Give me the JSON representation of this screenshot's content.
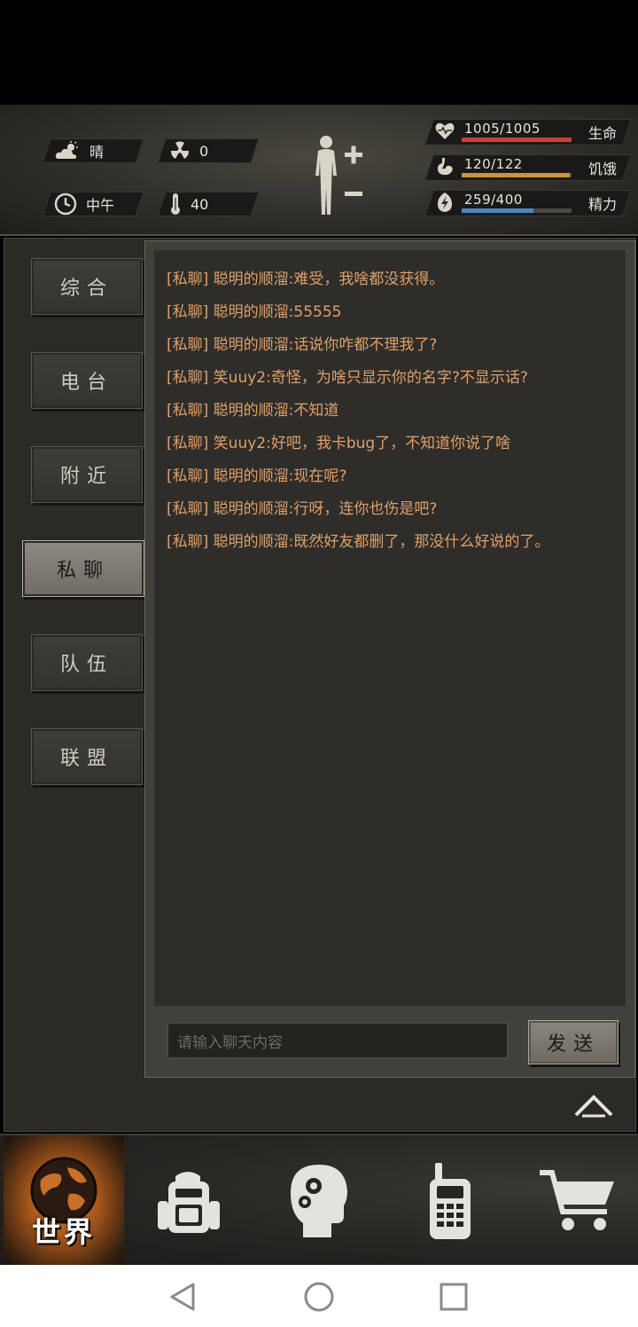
{
  "header": {
    "weather": {
      "icon": "cloud-sun-icon",
      "label": "晴"
    },
    "radiation": {
      "icon": "radiation-icon",
      "value": "0"
    },
    "time": {
      "icon": "clock-icon",
      "label": "中午"
    },
    "temperature": {
      "icon": "thermometer-icon",
      "value": "40"
    },
    "stats": [
      {
        "icon": "heart-icon",
        "value": "1005/1005",
        "name": "生命",
        "fraction": 1.0,
        "color": "#c9423a"
      },
      {
        "icon": "stomach-icon",
        "value": "120/122",
        "name": "饥饿",
        "fraction": 0.98,
        "color": "#c6982f"
      },
      {
        "icon": "energy-icon",
        "value": "259/400",
        "name": "精力",
        "fraction": 0.65,
        "color": "#4f86c6"
      }
    ]
  },
  "tabs": [
    {
      "label": "综合",
      "active": false
    },
    {
      "label": "电台",
      "active": false
    },
    {
      "label": "附近",
      "active": false
    },
    {
      "label": "私聊",
      "active": true
    },
    {
      "label": "队伍",
      "active": false
    },
    {
      "label": "联盟",
      "active": false
    }
  ],
  "chat": {
    "messages": [
      "[私聊] 聪明的顺溜:难受，我啥都没获得。",
      "[私聊] 聪明的顺溜:55555",
      "[私聊] 聪明的顺溜:话说你咋都不理我了?",
      "[私聊] 笑uuy2:奇怪，为啥只显示你的名字?不显示话?",
      "[私聊] 聪明的顺溜:不知道",
      "[私聊] 笑uuy2:好吧，我卡bug了，不知道你说了啥",
      "[私聊] 聪明的顺溜:现在呢?",
      "[私聊] 聪明的顺溜:行呀，连你也伤是吧?",
      "[私聊] 聪明的顺溜:既然好友都删了，那没什么好说的了。"
    ],
    "input_placeholder": "请输入聊天内容",
    "send_label": "发送"
  },
  "bottom_nav": [
    {
      "icon": "globe-icon",
      "label": "世界",
      "active": true
    },
    {
      "icon": "backpack-icon",
      "label": "",
      "active": false
    },
    {
      "icon": "head-gears-icon",
      "label": "",
      "active": false
    },
    {
      "icon": "walkie-talkie-icon",
      "label": "",
      "active": false
    },
    {
      "icon": "cart-icon",
      "label": "",
      "active": false
    }
  ]
}
